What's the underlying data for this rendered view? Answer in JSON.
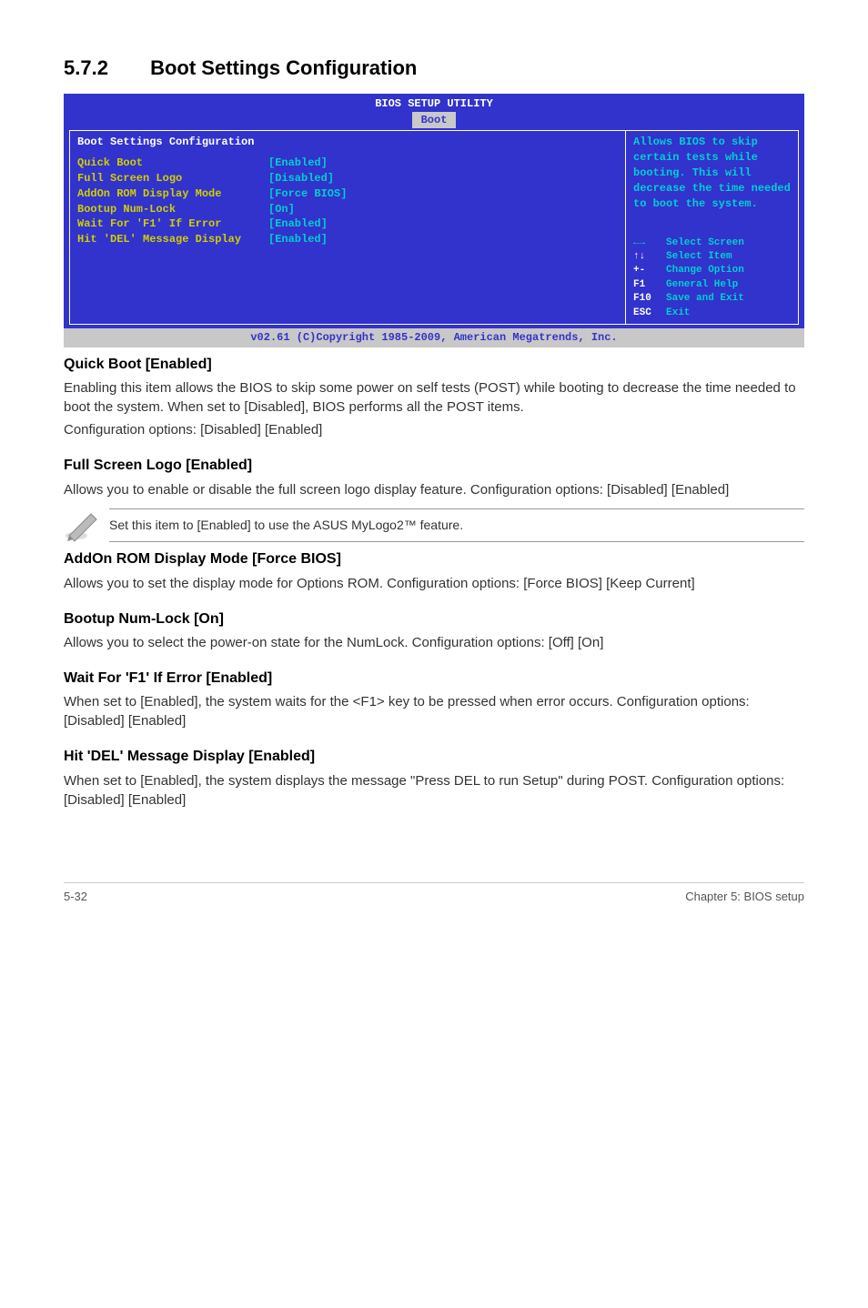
{
  "section": {
    "number": "5.7.2",
    "title": "Boot Settings Configuration"
  },
  "bios": {
    "title": "BIOS SETUP UTILITY",
    "tab": "Boot",
    "panel_header": "Boot Settings Configuration",
    "rows": [
      {
        "label": "Quick Boot",
        "value": "[Enabled]"
      },
      {
        "label": "Full Screen Logo",
        "value": "[Disabled]"
      },
      {
        "label": "AddOn ROM Display Mode",
        "value": "[Force BIOS]"
      },
      {
        "label": "Bootup Num-Lock",
        "value": "[On]"
      },
      {
        "label": "Wait For 'F1' If Error",
        "value": "[Enabled]"
      },
      {
        "label": "Hit 'DEL' Message Display",
        "value": "[Enabled]"
      }
    ],
    "help_text": "Allows BIOS to skip certain tests while booting. This will decrease the time needed to boot the system.",
    "keys": [
      {
        "key": "←→",
        "desc": "Select Screen"
      },
      {
        "key": "↑↓",
        "desc": "Select Item"
      },
      {
        "key": "+-",
        "desc": "Change Option"
      },
      {
        "key": "F1",
        "desc": "General Help"
      },
      {
        "key": "F10",
        "desc": "Save and Exit"
      },
      {
        "key": "ESC",
        "desc": "Exit"
      }
    ],
    "footer": "v02.61 (C)Copyright 1985-2009, American Megatrends, Inc."
  },
  "items": {
    "quick_boot": {
      "heading": "Quick Boot [Enabled]",
      "p1": "Enabling this item allows the BIOS to skip some power on self tests (POST) while booting to decrease the time needed to boot the system. When set to [Disabled], BIOS performs all the POST items.",
      "p2": "Configuration options: [Disabled] [Enabled]"
    },
    "full_screen": {
      "heading": "Full Screen Logo [Enabled]",
      "p1": "Allows you to enable or disable the full screen logo display feature. Configuration options: [Disabled] [Enabled]"
    },
    "note": "Set this item to [Enabled] to use the ASUS MyLogo2™ feature.",
    "addon_rom": {
      "heading": "AddOn ROM Display Mode [Force BIOS]",
      "p1": "Allows you to set the display mode for Options ROM. Configuration options: [Force BIOS] [Keep Current]"
    },
    "numlock": {
      "heading": "Bootup Num-Lock [On]",
      "p1": "Allows you to select the power-on state for the NumLock. Configuration options: [Off] [On]"
    },
    "wait_f1": {
      "heading": "Wait For 'F1' If Error [Enabled]",
      "p1": "When set to [Enabled], the system waits for the <F1> key to be pressed when error occurs. Configuration options: [Disabled] [Enabled]"
    },
    "hit_del": {
      "heading": "Hit 'DEL' Message Display [Enabled]",
      "p1": "When set to [Enabled], the system displays the message \"Press DEL to run Setup\" during POST. Configuration options: [Disabled] [Enabled]"
    }
  },
  "footer": {
    "left": "5-32",
    "right": "Chapter 5: BIOS setup"
  }
}
